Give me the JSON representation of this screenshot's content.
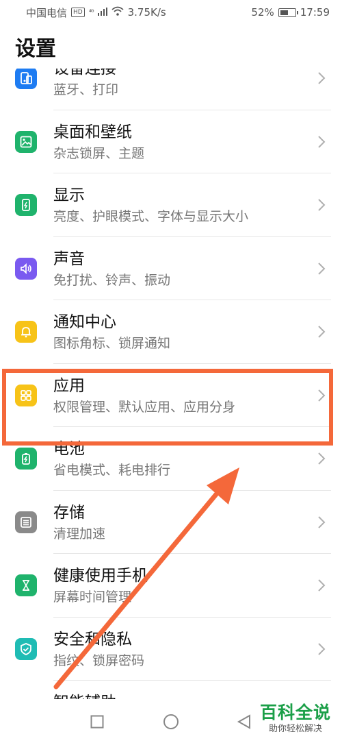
{
  "status": {
    "carrier": "中国电信",
    "hd": "HD",
    "signal": "⁴ᴳ",
    "speed": "3.75K/s",
    "battery_percent": "52%",
    "battery_level": 0.52,
    "time": "17:59"
  },
  "header": {
    "title": "设置"
  },
  "items": [
    {
      "title": "设备连接",
      "subtitle": "蓝牙、打印",
      "icon": "device-connect-icon",
      "color": "#1e7cf2"
    },
    {
      "title": "桌面和壁纸",
      "subtitle": "杂志锁屏、主题",
      "icon": "wallpaper-icon",
      "color": "#1fb36c"
    },
    {
      "title": "显示",
      "subtitle": "亮度、护眼模式、字体与显示大小",
      "icon": "display-icon",
      "color": "#1fb36c"
    },
    {
      "title": "声音",
      "subtitle": "免打扰、铃声、振动",
      "icon": "sound-icon",
      "color": "#7a5af0"
    },
    {
      "title": "通知中心",
      "subtitle": "图标角标、锁屏通知",
      "icon": "bell-icon",
      "color": "#f7c318"
    },
    {
      "title": "应用",
      "subtitle": "权限管理、默认应用、应用分身",
      "icon": "apps-grid-icon",
      "color": "#f7c318"
    },
    {
      "title": "电池",
      "subtitle": "省电模式、耗电排行",
      "icon": "battery-icon",
      "color": "#1fb36c"
    },
    {
      "title": "存储",
      "subtitle": "清理加速",
      "icon": "storage-icon",
      "color": "#8a8a8a"
    },
    {
      "title": "健康使用手机",
      "subtitle": "屏幕时间管理",
      "icon": "hourglass-icon",
      "color": "#1fb36c"
    },
    {
      "title": "安全和隐私",
      "subtitle": "指纹、锁屏密码",
      "icon": "shield-icon",
      "color": "#1fbcb4"
    },
    {
      "title": "智能辅助",
      "subtitle": "",
      "icon": "assist-icon",
      "color": "#f08a24"
    }
  ],
  "annotation": {
    "color": "#f4683a"
  },
  "watermark": {
    "title": "百科全说",
    "subtitle": "助你轻松解决"
  }
}
